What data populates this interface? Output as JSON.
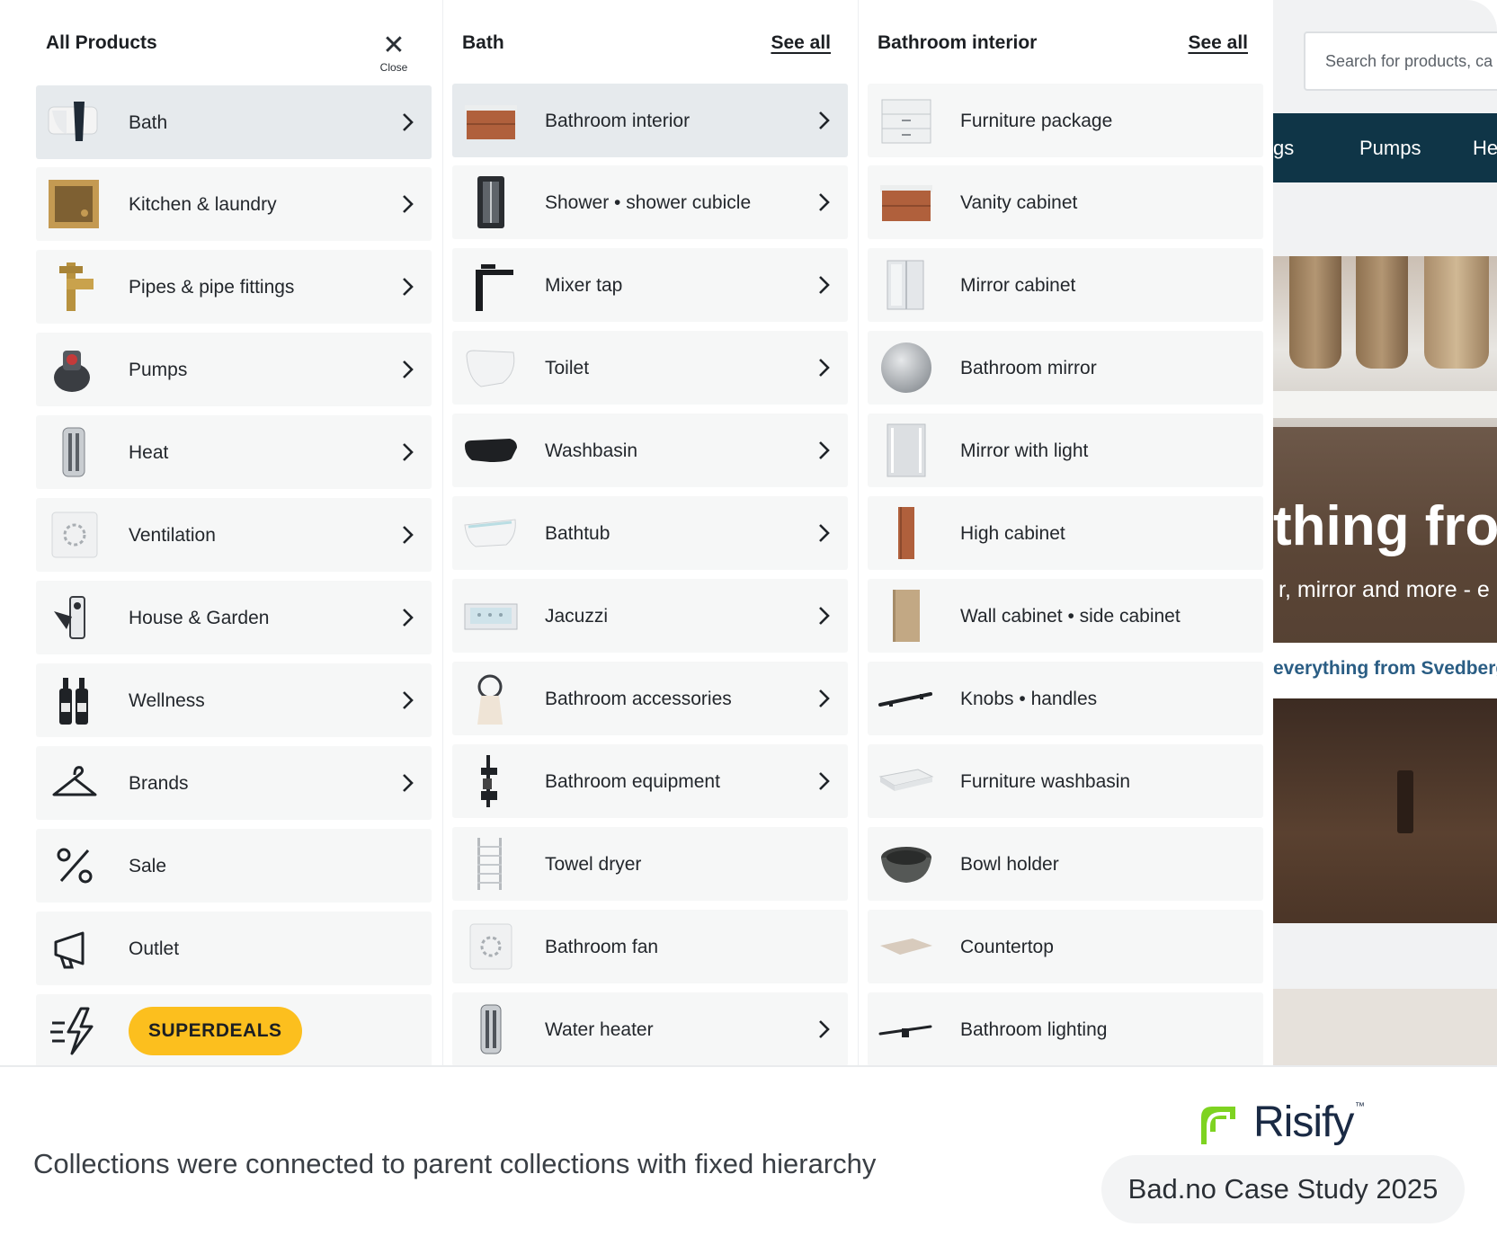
{
  "menu": {
    "col1": {
      "title": "All Products",
      "close_label": "Close",
      "items": [
        {
          "label": "Bath",
          "icon": "bath-basin-icon",
          "chevron": true
        },
        {
          "label": "Kitchen & laundry",
          "icon": "kitchen-sink-icon",
          "chevron": true
        },
        {
          "label": "Pipes & pipe fittings",
          "icon": "pipe-fitting-icon",
          "chevron": true
        },
        {
          "label": "Pumps",
          "icon": "pump-icon",
          "chevron": true
        },
        {
          "label": "Heat",
          "icon": "water-heater-icon",
          "chevron": true
        },
        {
          "label": "Ventilation",
          "icon": "fan-icon",
          "chevron": true
        },
        {
          "label": "House & Garden",
          "icon": "garden-tap-icon",
          "chevron": true
        },
        {
          "label": "Wellness",
          "icon": "bottles-icon",
          "chevron": true
        },
        {
          "label": "Brands",
          "icon": "hanger-icon",
          "chevron": true
        },
        {
          "label": "Sale",
          "icon": "percent-icon",
          "chevron": false
        },
        {
          "label": "Outlet",
          "icon": "megaphone-icon",
          "chevron": false
        },
        {
          "label": "SUPERDEALS",
          "icon": "lightning-icon",
          "chevron": false
        }
      ]
    },
    "col2": {
      "title": "Bath",
      "see_all": "See all",
      "items": [
        {
          "label": "Bathroom interior",
          "icon": "vanity-cabinet-icon",
          "chevron": true
        },
        {
          "label": "Shower • shower cubicle",
          "icon": "shower-cubicle-icon",
          "chevron": true
        },
        {
          "label": "Mixer tap",
          "icon": "mixer-tap-icon",
          "chevron": true
        },
        {
          "label": "Toilet",
          "icon": "toilet-icon",
          "chevron": true
        },
        {
          "label": "Washbasin",
          "icon": "washbasin-icon",
          "chevron": true
        },
        {
          "label": "Bathtub",
          "icon": "bathtub-icon",
          "chevron": true
        },
        {
          "label": "Jacuzzi",
          "icon": "jacuzzi-icon",
          "chevron": true
        },
        {
          "label": "Bathroom accessories",
          "icon": "towel-ring-icon",
          "chevron": true
        },
        {
          "label": "Bathroom equipment",
          "icon": "shower-caddy-icon",
          "chevron": true
        },
        {
          "label": "Towel dryer",
          "icon": "towel-dryer-icon",
          "chevron": false
        },
        {
          "label": "Bathroom fan",
          "icon": "bathroom-fan-icon",
          "chevron": false
        },
        {
          "label": "Water heater",
          "icon": "water-heater-icon",
          "chevron": true
        }
      ]
    },
    "col3": {
      "title": "Bathroom interior",
      "see_all": "See all",
      "items": [
        {
          "label": "Furniture package",
          "icon": "furniture-package-icon"
        },
        {
          "label": "Vanity cabinet",
          "icon": "vanity-cabinet-icon"
        },
        {
          "label": "Mirror cabinet",
          "icon": "mirror-cabinet-icon"
        },
        {
          "label": "Bathroom mirror",
          "icon": "round-mirror-icon"
        },
        {
          "label": "Mirror with light",
          "icon": "lit-mirror-icon"
        },
        {
          "label": "High cabinet",
          "icon": "high-cabinet-icon"
        },
        {
          "label": "Wall cabinet • side cabinet",
          "icon": "wall-cabinet-icon"
        },
        {
          "label": "Knobs • handles",
          "icon": "handle-icon"
        },
        {
          "label": "Furniture washbasin",
          "icon": "furniture-washbasin-icon"
        },
        {
          "label": "Bowl holder",
          "icon": "bowl-basin-icon"
        },
        {
          "label": "Countertop",
          "icon": "countertop-icon"
        },
        {
          "label": "Bathroom lighting",
          "icon": "bathroom-light-icon"
        }
      ]
    }
  },
  "site": {
    "search_placeholder": "Search for products, ca",
    "nav": [
      "gs",
      "Pumps",
      "He"
    ],
    "hero_title": "thing fror",
    "hero_subtitle": "r, mirror and more - e",
    "hero_band": "everything from Svedberg"
  },
  "footer": {
    "caption": "Collections were connected to parent collections with fixed hierarchy",
    "brand": "Risify",
    "trademark": "™",
    "study_label": "Bad.no Case Study 2025"
  },
  "colors": {
    "accent_yellow": "#fcbf1e",
    "nav_dark": "#0f3547",
    "brand_green": "#7ed321",
    "active_row": "#e6eaed"
  }
}
